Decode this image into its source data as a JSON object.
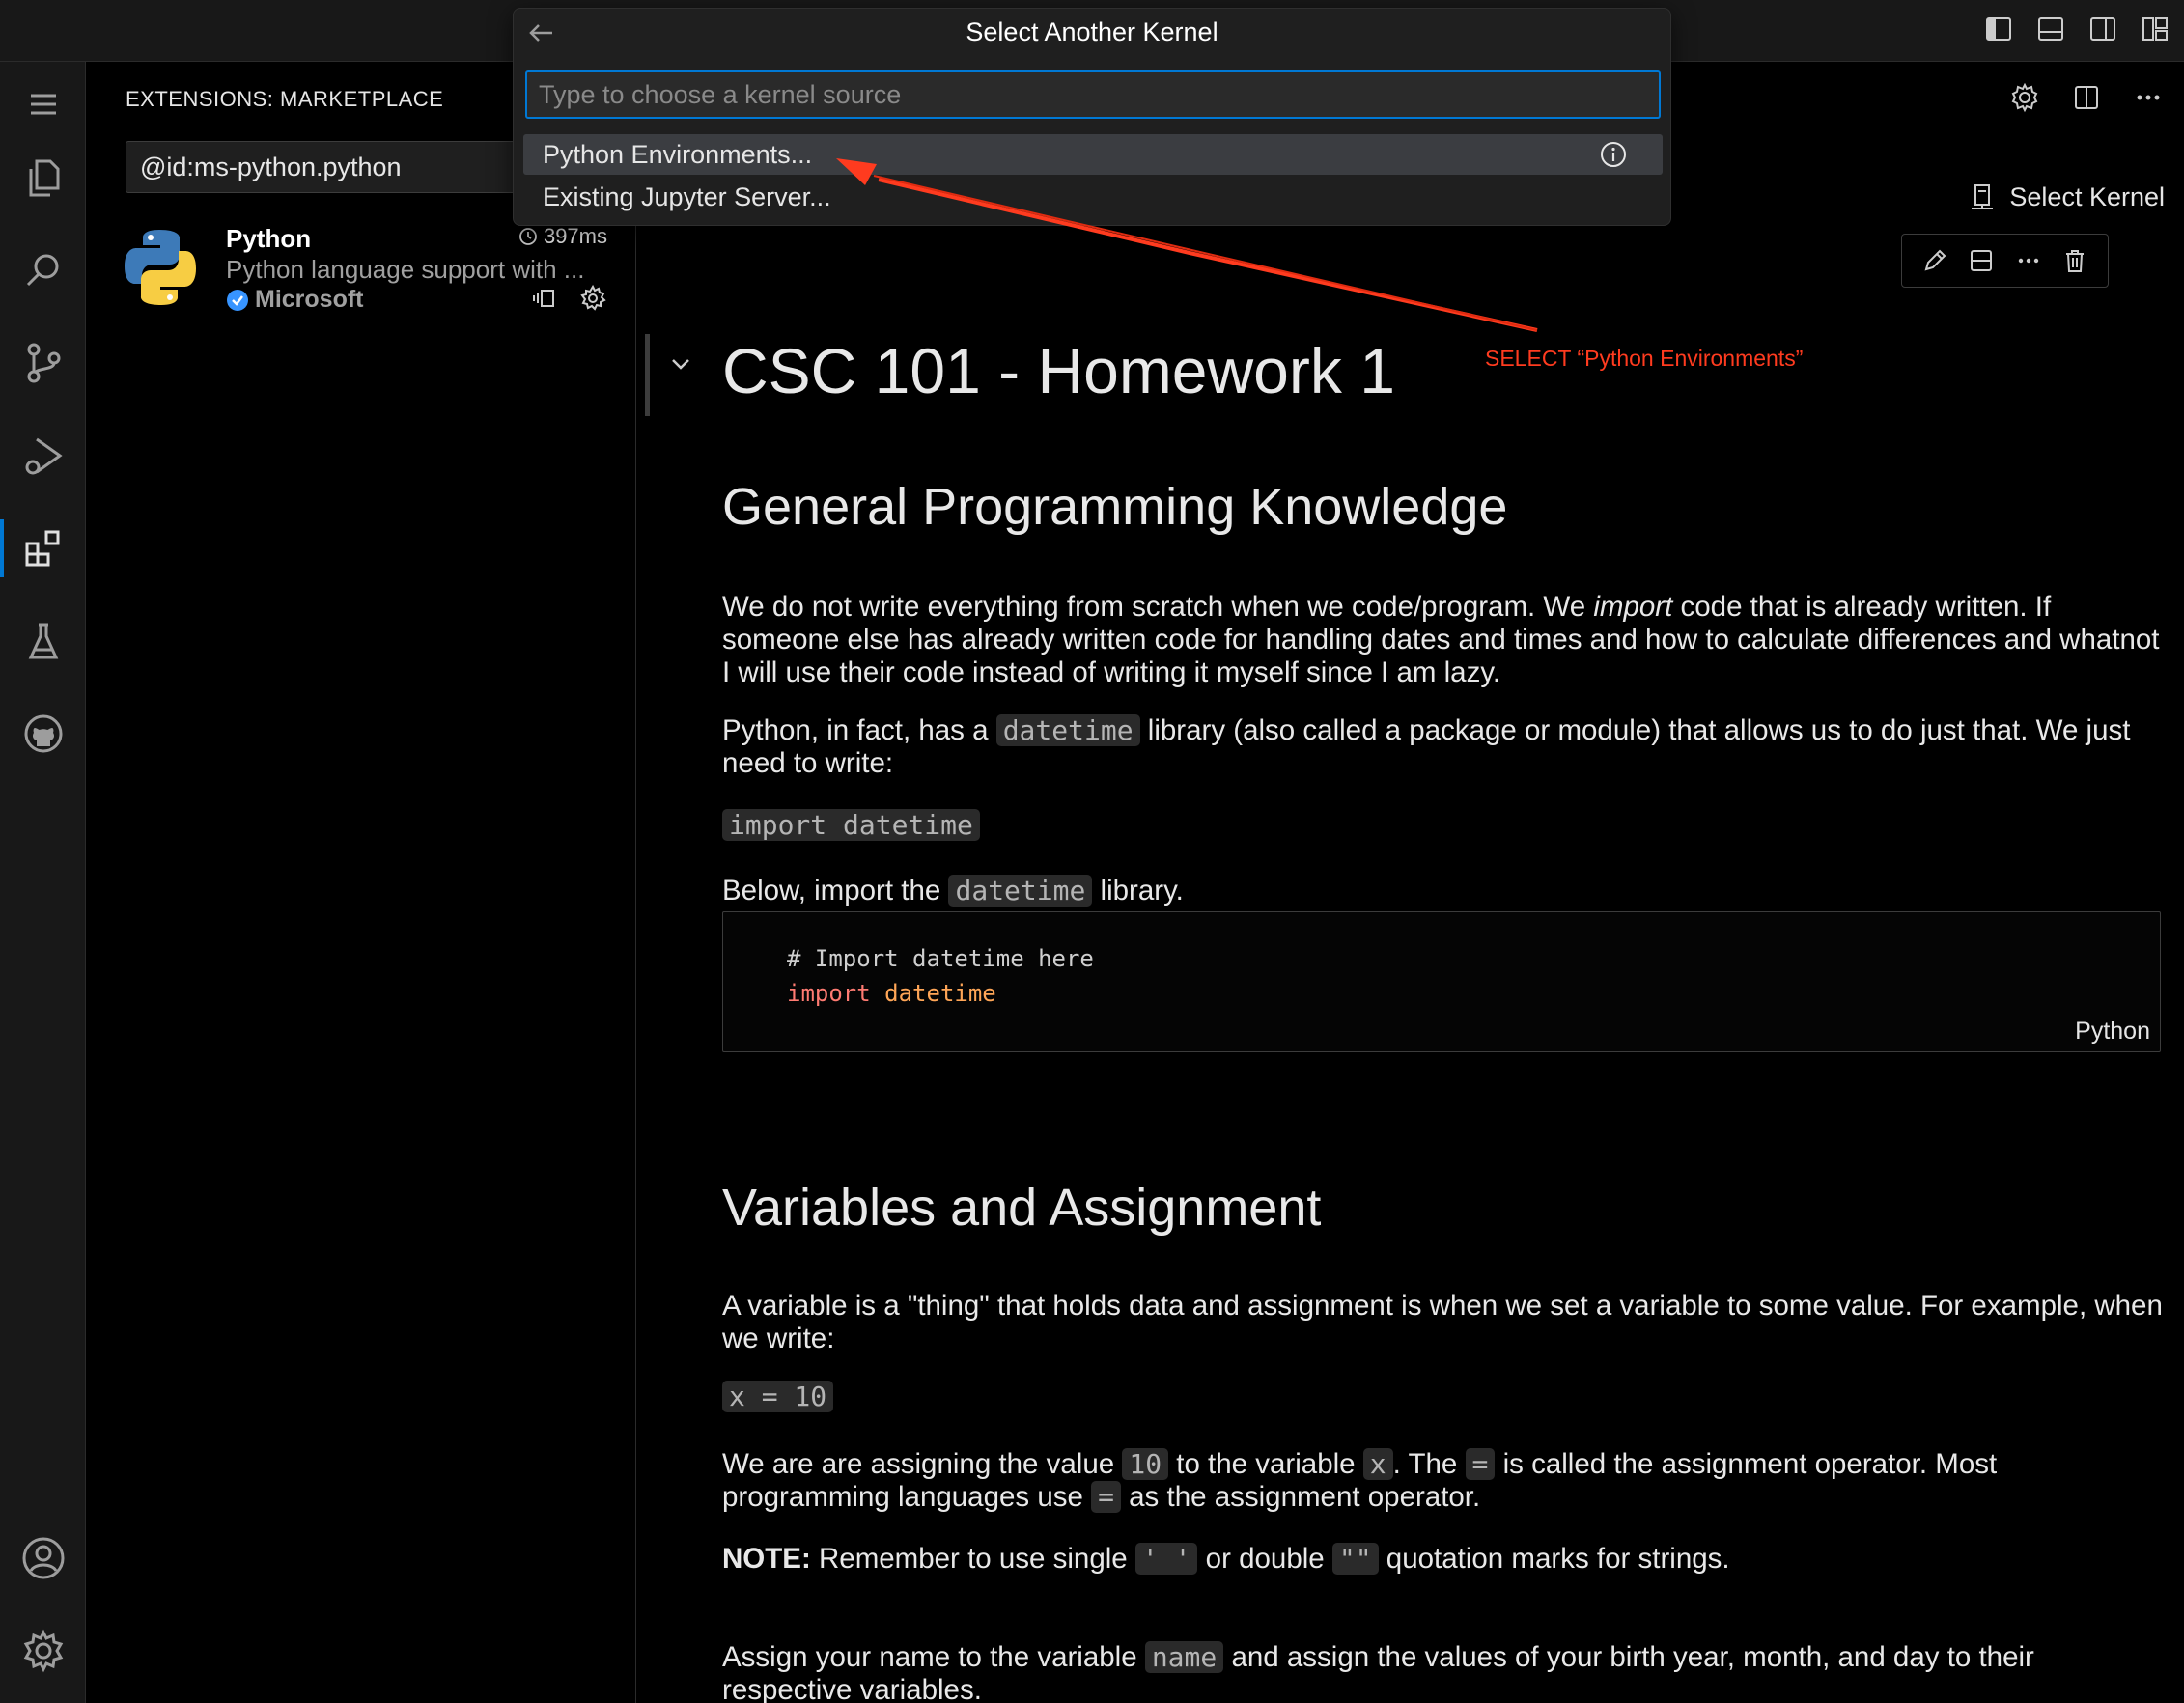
{
  "quick_pick": {
    "title": "Select Another Kernel",
    "input_placeholder": "Type to choose a kernel source",
    "items": [
      {
        "label": "Python Environments..."
      },
      {
        "label": "Existing Jupyter Server..."
      }
    ]
  },
  "annotation": {
    "text": "SELECT “Python Environments”",
    "color": "#ff3b1f"
  },
  "sidebar": {
    "title": "EXTENSIONS: MARKETPLACE",
    "search_value": "@id:ms-python.python",
    "extension": {
      "name": "Python",
      "description": "Python language support with ...",
      "publisher": "Microsoft",
      "time": "397ms"
    }
  },
  "editor": {
    "select_kernel_label": "Select Kernel",
    "notebook": {
      "h1": "CSC 101 - Homework 1",
      "h2_general": "General Programming Knowledge",
      "p1_a": "We do not write everything from scratch when we code/program. We ",
      "p1_em": "import",
      "p1_b": " code that is already written. If someone else has already written code for handling dates and times and how to calculate differences and whatnot I will use their code instead of writing it myself since I am lazy.",
      "p2_a": "Python, in fact, has a ",
      "p2_code": "datetime",
      "p2_b": " library (also called a package or module) that allows us to do just that. We just need to write:",
      "code_import": "import datetime",
      "p3_a": "Below, import the ",
      "p3_code": "datetime",
      "p3_b": " library.",
      "code_cell": {
        "comment": "# Import datetime here",
        "kw": "import",
        "module": "datetime",
        "language": "Python"
      },
      "h2_vars": "Variables and Assignment",
      "p4": "A variable is a \"thing\" that holds data and assignment is when we set a variable to some value. For example, when we write:",
      "code_x": "x = 10",
      "p5_a": "We are are assigning the value ",
      "p5_c1": "10",
      "p5_b": " to the variable ",
      "p5_c2": "x",
      "p5_c": ". The ",
      "p5_c3": "=",
      "p5_d": " is called the assignment operator. Most programming languages use ",
      "p5_c4": "=",
      "p5_e": " as the assignment operator.",
      "note_bold": "NOTE:",
      "note_a": " Remember to use single ",
      "note_c1": "' '",
      "note_b": " or double ",
      "note_c2": "\"\"",
      "note_c": " quotation marks for strings.",
      "p6_a": "Assign your name to the variable ",
      "p6_code": "name",
      "p6_b": " and assign the values of your birth year, month, and day to their respective variables."
    }
  },
  "colors": {
    "accent": "#0078d4",
    "background": "#000000",
    "panel": "#181818"
  }
}
